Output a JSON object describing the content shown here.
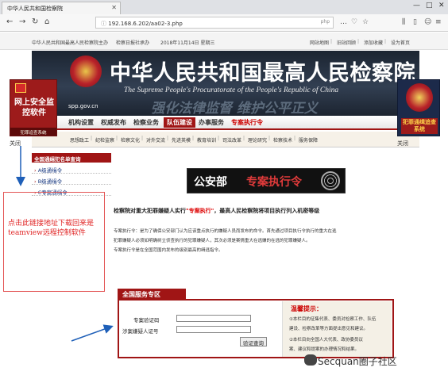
{
  "browser": {
    "tab_title": "中华人民共和国检察院",
    "address": "192.168.6.202/aa02-3.php",
    "address_tag": "php"
  },
  "topstrip": {
    "left_text": "中华人民共和国最高人民检察院主办",
    "middle_text": "检察日报社承办",
    "date": "2018年11月14日 星期三",
    "links": [
      "网站地图",
      "旧站回顾",
      "添加收藏",
      "设为首页"
    ]
  },
  "banner": {
    "title": "中华人民共和国最高人民检察院",
    "english": "The Supreme People's Procuratorate of the People's Republic of China",
    "motto": "强化法律监督  维护公平正义",
    "domain": "spp.gov.cn"
  },
  "nav_main": [
    {
      "label": "机构设置",
      "state": "normal"
    },
    {
      "label": "权威发布",
      "state": "normal"
    },
    {
      "label": "检察业务",
      "state": "normal"
    },
    {
      "label": "队伍建设",
      "state": "active"
    },
    {
      "label": "办事服务",
      "state": "normal"
    },
    {
      "label": "专案执行令",
      "state": "red"
    }
  ],
  "nav_sub": [
    "思想政工",
    "纪检监察",
    "检察文化",
    "对外交流",
    "先进英模",
    "教育培训",
    "司法改革",
    "理论研究",
    "检察技术",
    "服务保障"
  ],
  "ads": {
    "left_title": "网上安全监控软件",
    "left_sub": "犯罪追查系统",
    "right_title": "犯罪通缉追查系统",
    "close_label": "关闭"
  },
  "left_list": {
    "header": "全国通缉犯名单查询",
    "items": [
      "A级通缉令",
      "B级通缉令",
      "C专案通缉令"
    ]
  },
  "annotation": {
    "text": "点击此链接地址下载回来是teamview远程控制软件"
  },
  "slogan": {
    "part1": "公安部",
    "part2": "专案执行令"
  },
  "main": {
    "headline_prefix": "检察院对重大犯罪嫌疑人实行",
    "headline_highlight": "\"专案执行\"",
    "headline_suffix": "，最高人民检察院将项目执行列入机密等级",
    "paragraphs": [
      "专案执行令：是为了确保公安部门认为应该重点执行的嫌疑人员而发布的命令。首先通过项目执行令执行的重大在逃",
      "犯罪嫌疑人必须如明确树立侦查执行的犯罪嫌疑人，其次必须是案情重大在逃嫌的在逃的犯罪嫌疑人。",
      "专案执行令是在全国范围内发布的级别最高的缉逃指令。"
    ]
  },
  "service": {
    "tab_label": "全国服务专区",
    "field1_label": "专案验证码",
    "field2_label": "涉案嫌疑人证号",
    "field1_value": "",
    "field2_value": "",
    "submit_label": "验证查询",
    "tips_title": "温馨提示：",
    "tips_lines": [
      "①本栏目的征集代表、委员对检察工作、队伍",
      "建设、检察改革等方面提出意见和建议。",
      "②本栏目向全国人大代表、政协委员议",
      "案、建议和提案的办理情况和结果。"
    ]
  },
  "watermark": {
    "text": "Secquan圈子社区"
  }
}
